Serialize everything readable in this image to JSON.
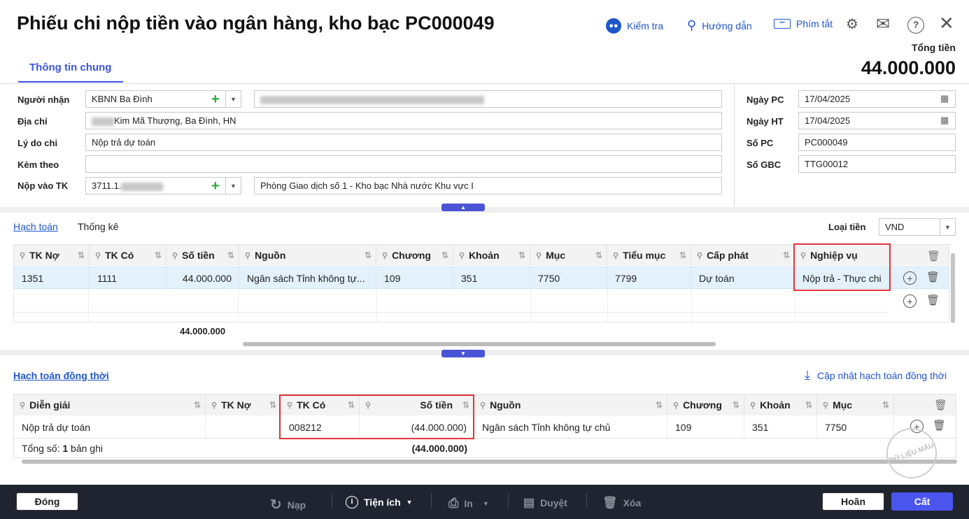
{
  "header": {
    "title": "Phiếu chi nộp tiền vào ngân hàng, kho bạc PC000049",
    "toolbar": {
      "check_label": "Kiểm tra",
      "guide_label": "Hướng dẫn",
      "shortcut_label": "Phím tắt"
    },
    "total_label": "Tổng tiền",
    "total_value": "44.000.000"
  },
  "tabs": {
    "general": "Thông tin chung"
  },
  "form": {
    "recipient_label": "Người nhận",
    "recipient_value": "KBNN Ba Đình",
    "address_label": "Địa chỉ",
    "address_value": "Kim Mã Thượng, Ba Đình, HN",
    "reason_label": "Lý do chi",
    "reason_value": "Nộp trả dự toán",
    "attach_label": "Kèm theo",
    "attach_value": "",
    "account_label": "Nộp vào TK",
    "account_value": "3711.1.",
    "account_name": "Phòng Giao dịch số 1 - Kho bạc Nhà nước Khu vực I",
    "date_pc_label": "Ngày PC",
    "date_pc_value": "17/04/2025",
    "date_ht_label": "Ngày HT",
    "date_ht_value": "17/04/2025",
    "so_pc_label": "Số PC",
    "so_pc_value": "PC000049",
    "so_gbc_label": "Số GBC",
    "so_gbc_value": "TTG00012"
  },
  "accounting": {
    "tab_accounting": "Hạch toán",
    "tab_stats": "Thống kê",
    "currency_label": "Loại tiền",
    "currency_value": "VND",
    "columns": [
      "TK Nợ",
      "TK Có",
      "Số tiền",
      "Nguồn",
      "Chương",
      "Khoản",
      "Mục",
      "Tiểu mục",
      "Cấp phát",
      "Nghiệp vụ"
    ],
    "row": [
      "1351",
      "1111",
      "44.000.000",
      "Ngân sách Tỉnh không tự...",
      "109",
      "351",
      "7750",
      "7799",
      "Dự toán",
      "Nộp trả - Thực chi"
    ],
    "total": "44.000.000"
  },
  "simultaneous": {
    "title": "Hạch toán đồng thời",
    "update_label": "Cập nhật hạch toán đồng thời",
    "columns": [
      "Diễn giải",
      "TK Nợ",
      "TK Có",
      "Số tiền",
      "Nguồn",
      "Chương",
      "Khoản",
      "Mục"
    ],
    "row": [
      "Nộp trả dự toán",
      "",
      "008212",
      "(44.000.000)",
      "Ngân sách Tỉnh không tự chủ",
      "109",
      "351",
      "7750"
    ],
    "summary_prefix": "Tổng số: ",
    "summary_count": "1",
    "summary_suffix": " bản ghi",
    "total": "(44.000.000)"
  },
  "watermark": "DỮ LIỆU MẪU",
  "footer": {
    "close": "Đóng",
    "load": "Nạp",
    "utility": "Tiện ích",
    "print": "In",
    "approve": "Duyệt",
    "delete": "Xóa",
    "cancel": "Hoãn",
    "save": "Cất"
  }
}
